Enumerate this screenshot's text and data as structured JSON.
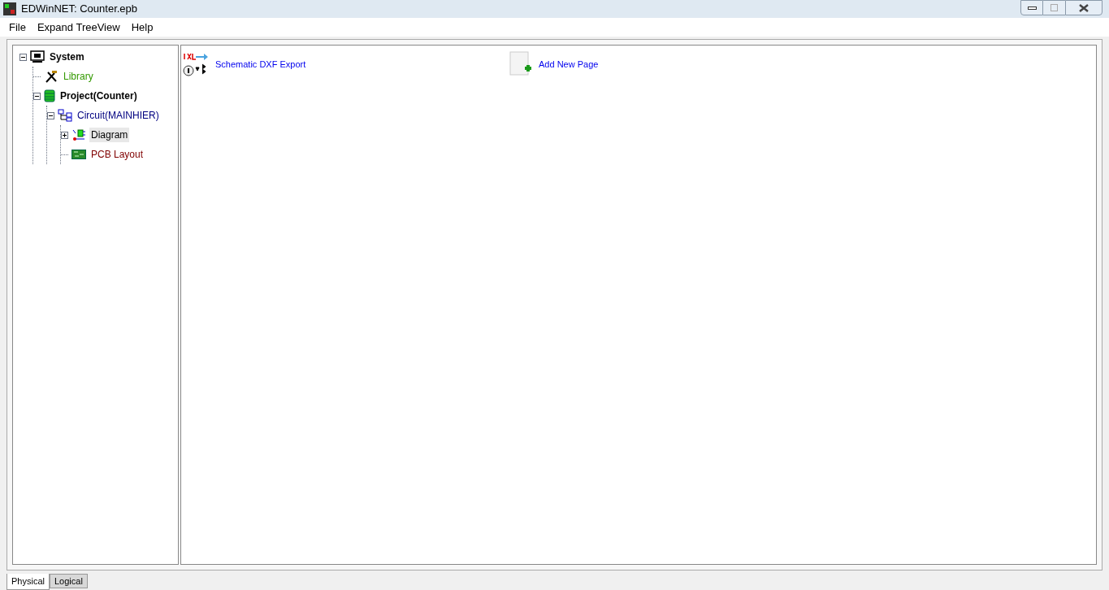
{
  "window": {
    "title": "EDWinNET: Counter.epb"
  },
  "menu": [
    "File",
    "Expand TreeView",
    "Help"
  ],
  "tree": [
    {
      "label": "System",
      "kind": "system",
      "bold": true,
      "color": "#000000",
      "expanded": true,
      "selected": false,
      "children": [
        {
          "label": "Library",
          "kind": "library",
          "bold": false,
          "color": "#339900",
          "selected": false
        },
        {
          "label": "Project(Counter)",
          "kind": "project",
          "bold": true,
          "color": "#000000",
          "expanded": true,
          "selected": false,
          "children": [
            {
              "label": "Circuit(MAINHIER)",
              "kind": "circuit",
              "bold": false,
              "color": "#000080",
              "expanded": true,
              "selected": false,
              "children": [
                {
                  "label": "Diagram",
                  "kind": "diagram",
                  "bold": false,
                  "color": "#000000",
                  "expanded": false,
                  "selected": true
                },
                {
                  "label": "PCB Layout",
                  "kind": "pcb",
                  "bold": false,
                  "color": "#800000",
                  "selected": false
                }
              ]
            }
          ]
        }
      ]
    }
  ],
  "actions": [
    {
      "label": "Schematic DXF Export",
      "kind": "dxf"
    },
    {
      "label": "Add New Page",
      "kind": "page"
    }
  ],
  "tabs": [
    {
      "label": "Physical",
      "selected": true
    },
    {
      "label": "Logical",
      "selected": false
    }
  ]
}
